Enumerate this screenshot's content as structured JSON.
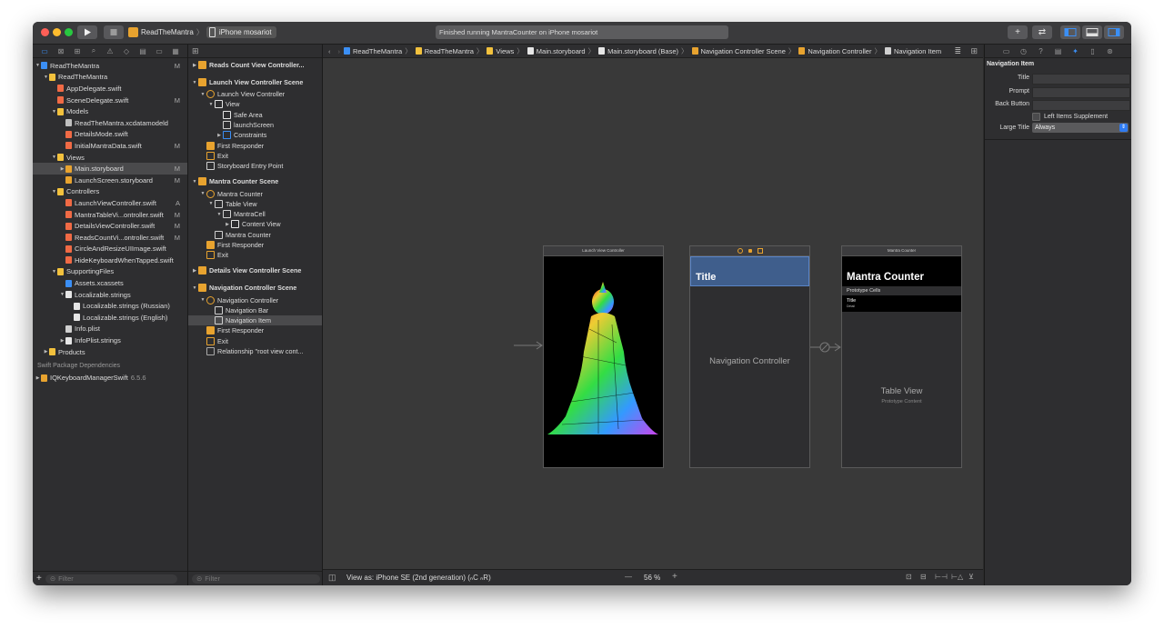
{
  "toolbar": {
    "scheme_name": "ReadTheMantra",
    "device_name": "iPhone mosariot",
    "status_text": "Finished running MantraCounter on iPhone mosariot",
    "library_icon": "+",
    "review_icon": "⇄",
    "play_icon": "play-icon",
    "stop_icon": "stop-icon"
  },
  "navigator": {
    "tabs": [
      "folder-icon",
      "source-control-icon",
      "symbol-icon",
      "find-icon",
      "issue-icon",
      "test-icon",
      "debug-icon",
      "breakpoint-icon",
      "report-icon"
    ],
    "tree": [
      {
        "label": "ReadTheMantra",
        "depth": 0,
        "tri": "▼",
        "icon": "project",
        "badge": "M"
      },
      {
        "label": "ReadTheMantra",
        "depth": 1,
        "tri": "▼",
        "icon": "folder",
        "badge": ""
      },
      {
        "label": "AppDelegate.swift",
        "depth": 2,
        "tri": "",
        "icon": "swift",
        "badge": ""
      },
      {
        "label": "SceneDelegate.swift",
        "depth": 2,
        "tri": "",
        "icon": "swift",
        "badge": "M"
      },
      {
        "label": "Models",
        "depth": 2,
        "tri": "▼",
        "icon": "folder",
        "badge": ""
      },
      {
        "label": "ReadTheMantra.xcdatamodeld",
        "depth": 3,
        "tri": "",
        "icon": "data",
        "badge": ""
      },
      {
        "label": "DetailsMode.swift",
        "depth": 3,
        "tri": "",
        "icon": "swift",
        "badge": ""
      },
      {
        "label": "InitialMantraData.swift",
        "depth": 3,
        "tri": "",
        "icon": "swift",
        "badge": "M"
      },
      {
        "label": "Views",
        "depth": 2,
        "tri": "▼",
        "icon": "folder",
        "badge": ""
      },
      {
        "label": "Main.storyboard",
        "depth": 3,
        "tri": "▶",
        "icon": "storyboard",
        "badge": "M",
        "selected": true
      },
      {
        "label": "LaunchScreen.storyboard",
        "depth": 3,
        "tri": "",
        "icon": "storyboard",
        "badge": "M"
      },
      {
        "label": "Controllers",
        "depth": 2,
        "tri": "▼",
        "icon": "folder",
        "badge": ""
      },
      {
        "label": "LaunchViewController.swift",
        "depth": 3,
        "tri": "",
        "icon": "swift",
        "badge": "A"
      },
      {
        "label": "MantraTableVi...ontroller.swift",
        "depth": 3,
        "tri": "",
        "icon": "swift",
        "badge": "M"
      },
      {
        "label": "DetailsViewController.swift",
        "depth": 3,
        "tri": "",
        "icon": "swift",
        "badge": "M"
      },
      {
        "label": "ReadsCountVi...ontroller.swift",
        "depth": 3,
        "tri": "",
        "icon": "swift",
        "badge": "M"
      },
      {
        "label": "CircleAndResizeUIImage.swift",
        "depth": 3,
        "tri": "",
        "icon": "swift",
        "badge": ""
      },
      {
        "label": "HideKeyboardWhenTapped.swift",
        "depth": 3,
        "tri": "",
        "icon": "swift",
        "badge": ""
      },
      {
        "label": "SupportingFiles",
        "depth": 2,
        "tri": "▼",
        "icon": "folder",
        "badge": ""
      },
      {
        "label": "Assets.xcassets",
        "depth": 3,
        "tri": "",
        "icon": "assets",
        "badge": ""
      },
      {
        "label": "Localizable.strings",
        "depth": 3,
        "tri": "▼",
        "icon": "strings",
        "badge": ""
      },
      {
        "label": "Localizable.strings (Russian)",
        "depth": 4,
        "tri": "",
        "icon": "strings",
        "badge": ""
      },
      {
        "label": "Localizable.strings (English)",
        "depth": 4,
        "tri": "",
        "icon": "strings",
        "badge": ""
      },
      {
        "label": "Info.plist",
        "depth": 3,
        "tri": "",
        "icon": "plist",
        "badge": ""
      },
      {
        "label": "InfoPlist.strings",
        "depth": 3,
        "tri": "▶",
        "icon": "strings",
        "badge": ""
      },
      {
        "label": "Products",
        "depth": 1,
        "tri": "▶",
        "icon": "folder",
        "badge": ""
      }
    ],
    "package_section_title": "Swift Package Dependencies",
    "package": {
      "name": "IQKeyboardManagerSwift",
      "version": "6.5.6"
    },
    "filter_placeholder": "Filter"
  },
  "outline": {
    "rows": [
      {
        "label": "Reads Count View Controller...",
        "depth": 0,
        "tri": "▶",
        "icon": "scene",
        "header": true
      },
      {
        "label": "Launch View Controller Scene",
        "depth": 0,
        "tri": "▼",
        "icon": "scene",
        "header": true
      },
      {
        "label": "Launch View Controller",
        "depth": 1,
        "tri": "▼",
        "icon": "vc"
      },
      {
        "label": "View",
        "depth": 2,
        "tri": "▼",
        "icon": "view"
      },
      {
        "label": "Safe Area",
        "depth": 3,
        "tri": "",
        "icon": "view"
      },
      {
        "label": "launchScreen",
        "depth": 3,
        "tri": "",
        "icon": "image"
      },
      {
        "label": "Constraints",
        "depth": 3,
        "tri": "▶",
        "icon": "constraint"
      },
      {
        "label": "First Responder",
        "depth": 1,
        "tri": "",
        "icon": "responder"
      },
      {
        "label": "Exit",
        "depth": 1,
        "tri": "",
        "icon": "exit"
      },
      {
        "label": "Storyboard Entry Point",
        "depth": 1,
        "tri": "",
        "icon": "entry"
      },
      {
        "label": "Mantra Counter Scene",
        "depth": 0,
        "tri": "▼",
        "icon": "scene",
        "header": true
      },
      {
        "label": "Mantra Counter",
        "depth": 1,
        "tri": "▼",
        "icon": "vc"
      },
      {
        "label": "Table View",
        "depth": 2,
        "tri": "▼",
        "icon": "table"
      },
      {
        "label": "MantraCell",
        "depth": 3,
        "tri": "▼",
        "icon": "table"
      },
      {
        "label": "Content View",
        "depth": 4,
        "tri": "▶",
        "icon": "view"
      },
      {
        "label": "Mantra Counter",
        "depth": 2,
        "tri": "",
        "icon": "navitem"
      },
      {
        "label": "First Responder",
        "depth": 1,
        "tri": "",
        "icon": "responder"
      },
      {
        "label": "Exit",
        "depth": 1,
        "tri": "",
        "icon": "exit"
      },
      {
        "label": "Details View Controller Scene",
        "depth": 0,
        "tri": "▶",
        "icon": "scene",
        "header": true
      },
      {
        "label": "Navigation Controller Scene",
        "depth": 0,
        "tri": "▼",
        "icon": "scene",
        "header": true
      },
      {
        "label": "Navigation Controller",
        "depth": 1,
        "tri": "▼",
        "icon": "navc"
      },
      {
        "label": "Navigation Bar",
        "depth": 2,
        "tri": "",
        "icon": "navbar"
      },
      {
        "label": "Navigation Item",
        "depth": 2,
        "tri": "",
        "icon": "navitem",
        "selected": true
      },
      {
        "label": "First Responder",
        "depth": 1,
        "tri": "",
        "icon": "responder"
      },
      {
        "label": "Exit",
        "depth": 1,
        "tri": "",
        "icon": "exit"
      },
      {
        "label": "Relationship \"root view cont...",
        "depth": 1,
        "tri": "",
        "icon": "relationship"
      }
    ],
    "filter_placeholder": "Filter"
  },
  "jumpbar": [
    "ReadTheMantra",
    "ReadTheMantra",
    "Views",
    "Main.storyboard",
    "Main.storyboard (Base)",
    "Navigation Controller Scene",
    "Navigation Controller",
    "Navigation Item"
  ],
  "canvas": {
    "launch": {
      "header": "Launch View Controller"
    },
    "nav": {
      "title": "Title",
      "center_label": "Navigation Controller"
    },
    "mantra": {
      "header": "Mantra Counter",
      "large_title": "Mantra Counter",
      "prototype_cells": "Prototype Cells",
      "cell_title": "Title",
      "cell_detail": "Detail",
      "table_label": "Table View",
      "prototype_content": "Prototype Content"
    }
  },
  "bottombar": {
    "view_as": "View as: iPhone SE (2nd generation) (ₙC ₙR)",
    "zoom_minus": "—",
    "zoom": "56 %",
    "zoom_plus": "+"
  },
  "inspector": {
    "section_title": "Navigation Item",
    "title_label": "Title",
    "prompt_label": "Prompt",
    "back_button_label": "Back Button",
    "left_items_label": "Left Items Supplement",
    "large_title_label": "Large Title",
    "large_title_value": "Always"
  }
}
